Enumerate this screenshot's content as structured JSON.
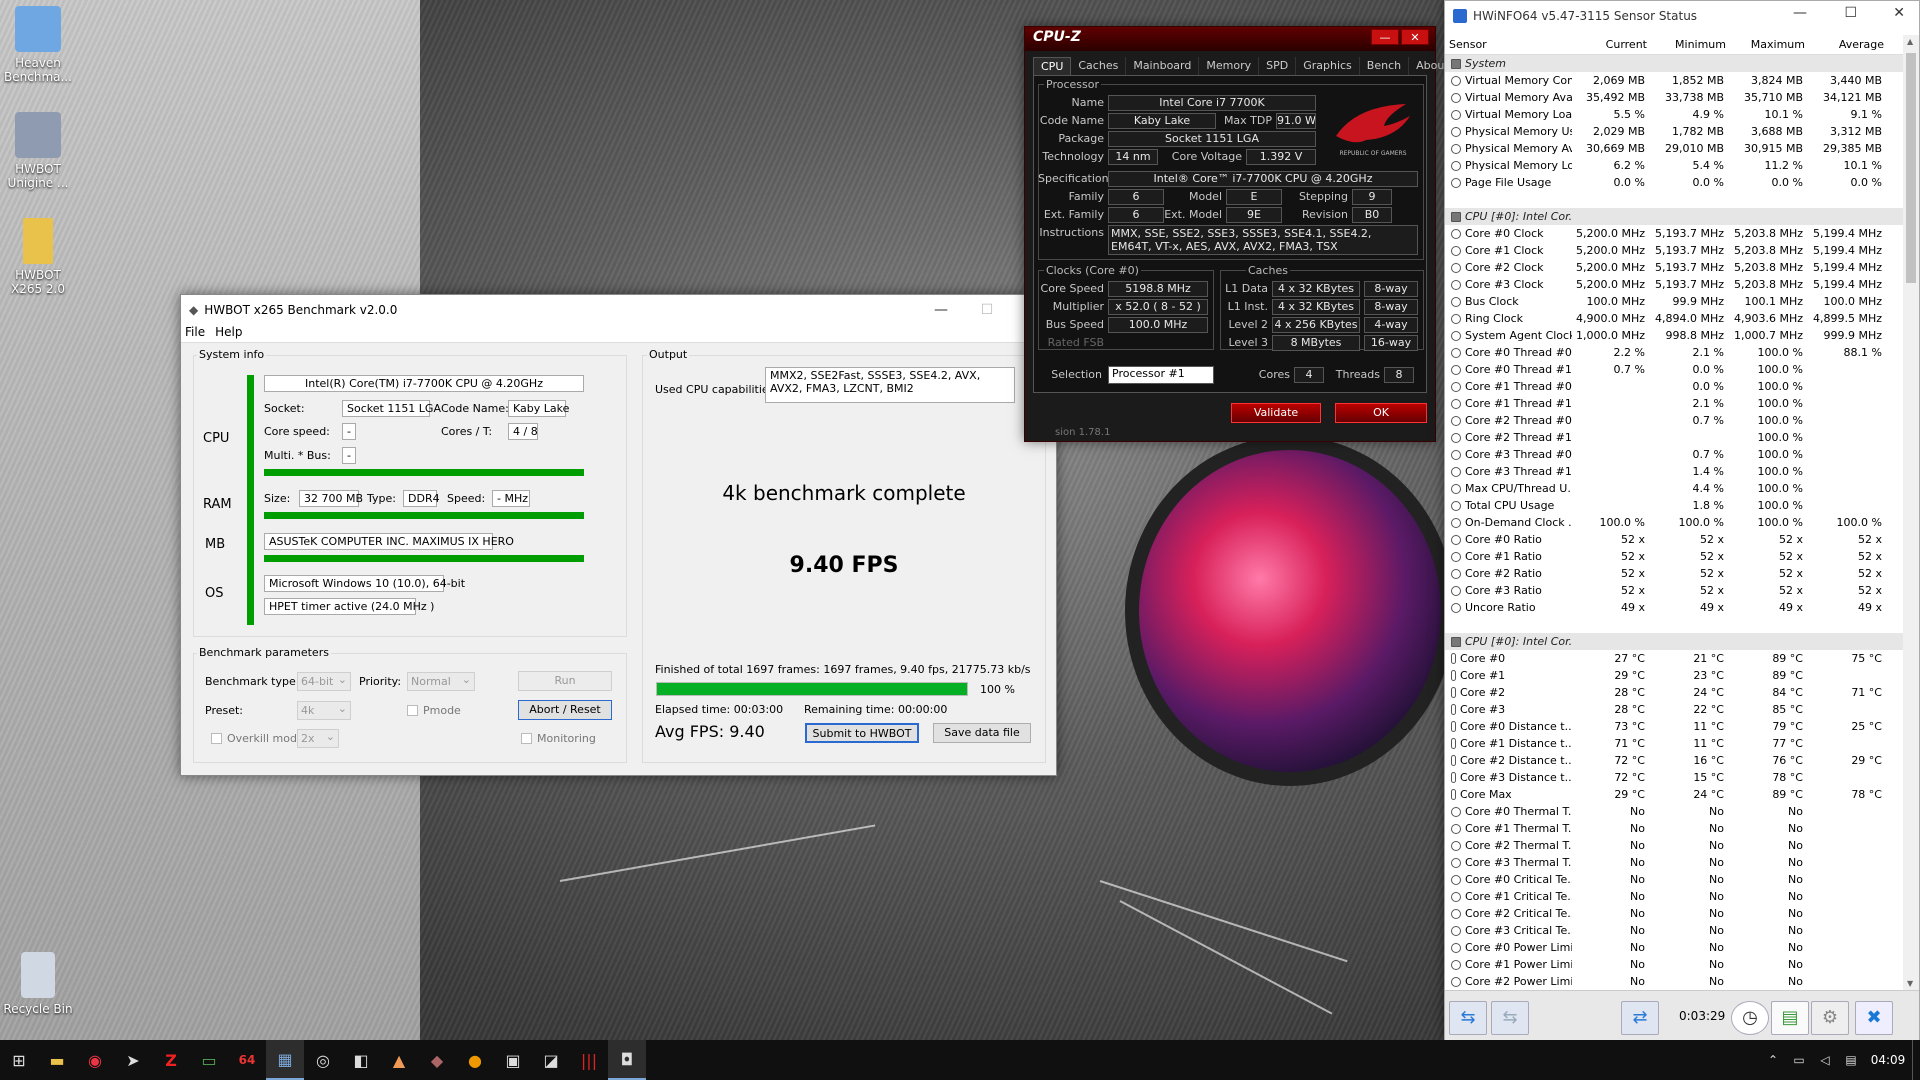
{
  "desktop": {
    "icons": [
      {
        "label": "Heaven Benchma...",
        "color": "#6fa7e2"
      },
      {
        "label": "HWBOT Unigine ...",
        "color": "#8f9bb0"
      },
      {
        "label": "HWBOT X265 2.0",
        "color": "#e8c24a"
      },
      {
        "label": "Recycle Bin",
        "color": "#cfd8e3"
      }
    ]
  },
  "hwbot": {
    "title": "HWBOT x265 Benchmark v2.0.0",
    "menu": [
      "File",
      "Help"
    ],
    "system_info": {
      "group": "System info",
      "cpu_label": "CPU",
      "ram_label": "RAM",
      "mb_label": "MB",
      "os_label": "OS",
      "cpu_name": "Intel(R) Core(TM) i7-7700K CPU @ 4.20GHz",
      "socket_label": "Socket:",
      "socket": "Socket 1151 LGA",
      "codename_label": "Code Name:",
      "codename": "Kaby Lake",
      "corespeed_label": "Core speed:",
      "corespeed": "-",
      "cores_label": "Cores / T:",
      "cores": "4 / 8",
      "multi_label": "Multi. * Bus:",
      "multi": "-",
      "size_label": "Size:",
      "size": "32 700 MB",
      "type_label": "Type:",
      "type": "DDR4",
      "speed_label": "Speed:",
      "speed": "- MHz",
      "mb": "ASUSTeK COMPUTER INC. MAXIMUS IX HERO",
      "os": "Microsoft Windows 10 (10.0), 64-bit",
      "timer": "HPET timer active (24.0 MHz )"
    },
    "params": {
      "group": "Benchmark parameters",
      "bt_label": "Benchmark type:",
      "bt": "64-bit",
      "prio_label": "Priority:",
      "prio": "Normal",
      "run": "Run",
      "preset_label": "Preset:",
      "preset": "4k",
      "pmode": "Pmode",
      "abort": "Abort / Reset",
      "overkill": "Overkill mode",
      "overkill_val": "2x",
      "monitoring": "Monitoring"
    },
    "output": {
      "group": "Output",
      "caps_label": "Used CPU capabilities:",
      "caps": "MMX2, SSE2Fast, SSSE3, SSE4.2, AVX, AVX2, FMA3, LZCNT, BMI2",
      "status": "4k benchmark complete",
      "fps": "9.40 FPS",
      "finished": "Finished of total 1697 frames: 1697 frames, 9.40 fps,  21775.73 kb/s",
      "progress": 1.0,
      "progress_text": "100 %",
      "elapsed": "Elapsed time: 00:03:00",
      "remaining": "Remaining time: 00:00:00",
      "avg": "Avg FPS:  9.40",
      "submit": "Submit to HWBOT",
      "save": "Save data file"
    }
  },
  "cpuz": {
    "title": "CPU-Z",
    "tabs": [
      "CPU",
      "Caches",
      "Mainboard",
      "Memory",
      "SPD",
      "Graphics",
      "Bench",
      "About"
    ],
    "processor_group": "Processor",
    "name_label": "Name",
    "name": "Intel Core i7 7700K",
    "code_label": "Code Name",
    "code": "Kaby Lake",
    "tdp_label": "Max TDP",
    "tdp": "91.0 W",
    "pkg_label": "Package",
    "pkg": "Socket 1151 LGA",
    "tech_label": "Technology",
    "tech": "14 nm",
    "cv_label": "Core Voltage",
    "cv": "1.392 V",
    "spec_label": "Specification",
    "spec": "Intel® Core™ i7-7700K CPU @ 4.20GHz",
    "family_label": "Family",
    "family": "6",
    "model_label": "Model",
    "model": "E",
    "stepping_label": "Stepping",
    "stepping": "9",
    "extfam_label": "Ext. Family",
    "extfam": "6",
    "extmodel_label": "Ext. Model",
    "extmodel": "9E",
    "rev_label": "Revision",
    "rev": "B0",
    "instr_label": "Instructions",
    "instr": "MMX, SSE, SSE2, SSE3, SSSE3, SSE4.1, SSE4.2, EM64T, VT-x, AES, AVX, AVX2, FMA3, TSX",
    "clocks_group": "Clocks (Core #0)",
    "cs_label": "Core Speed",
    "cs": "5198.8 MHz",
    "mult_label": "Multiplier",
    "mult": "x 52.0 ( 8 - 52 )",
    "bus_label": "Bus Speed",
    "bus": "100.0 MHz",
    "fsb_label": "Rated FSB",
    "caches_group": "Caches",
    "l1d_label": "L1 Data",
    "l1d": "4 x 32 KBytes",
    "l1d_w": "8-way",
    "l1i_label": "L1 Inst.",
    "l1i": "4 x 32 KBytes",
    "l1i_w": "8-way",
    "l2_label": "Level 2",
    "l2": "4 x 256 KBytes",
    "l2_w": "4-way",
    "l3_label": "Level 3",
    "l3": "8 MBytes",
    "l3_w": "16-way",
    "sel_label": "Selection",
    "sel": "Processor #1",
    "cores_label": "Cores",
    "cores": "4",
    "threads_label": "Threads",
    "threads": "8",
    "validate": "Validate",
    "ok": "OK",
    "version": "sion 1.78.1",
    "logo_text": "REPUBLIC OF GAMERS"
  },
  "hwinfo": {
    "title": "HWiNFO64 v5.47-3115 Sensor Status",
    "cols": [
      "Sensor",
      "Current",
      "Minimum",
      "Maximum",
      "Average"
    ],
    "rows": [
      {
        "s": 1,
        "n": "System"
      },
      {
        "n": "Virtual Memory Com...",
        "v": [
          "2,069 MB",
          "1,852 MB",
          "3,824 MB",
          "3,440 MB"
        ]
      },
      {
        "n": "Virtual Memory Avai...",
        "v": [
          "35,492 MB",
          "33,738 MB",
          "35,710 MB",
          "34,121 MB"
        ]
      },
      {
        "n": "Virtual Memory Load",
        "v": [
          "5.5 %",
          "4.9 %",
          "10.1 %",
          "9.1 %"
        ]
      },
      {
        "n": "Physical Memory Used",
        "v": [
          "2,029 MB",
          "1,782 MB",
          "3,688 MB",
          "3,312 MB"
        ]
      },
      {
        "n": "Physical Memory Av...",
        "v": [
          "30,669 MB",
          "29,010 MB",
          "30,915 MB",
          "29,385 MB"
        ]
      },
      {
        "n": "Physical Memory Load",
        "v": [
          "6.2 %",
          "5.4 %",
          "11.2 %",
          "10.1 %"
        ]
      },
      {
        "n": "Page File Usage",
        "v": [
          "0.0 %",
          "0.0 %",
          "0.0 %",
          "0.0 %"
        ]
      },
      {
        "gap": 1
      },
      {
        "s": 1,
        "n": "CPU [#0]: Intel Cor..."
      },
      {
        "n": "Core #0 Clock",
        "v": [
          "5,200.0 MHz",
          "5,193.7 MHz",
          "5,203.8 MHz",
          "5,199.4 MHz"
        ]
      },
      {
        "n": "Core #1 Clock",
        "v": [
          "5,200.0 MHz",
          "5,193.7 MHz",
          "5,203.8 MHz",
          "5,199.4 MHz"
        ]
      },
      {
        "n": "Core #2 Clock",
        "v": [
          "5,200.0 MHz",
          "5,193.7 MHz",
          "5,203.8 MHz",
          "5,199.4 MHz"
        ]
      },
      {
        "n": "Core #3 Clock",
        "v": [
          "5,200.0 MHz",
          "5,193.7 MHz",
          "5,203.8 MHz",
          "5,199.4 MHz"
        ]
      },
      {
        "n": "Bus Clock",
        "v": [
          "100.0 MHz",
          "99.9 MHz",
          "100.1 MHz",
          "100.0 MHz"
        ]
      },
      {
        "n": "Ring Clock",
        "v": [
          "4,900.0 MHz",
          "4,894.0 MHz",
          "4,903.6 MHz",
          "4,899.5 MHz"
        ]
      },
      {
        "n": "System Agent Clock",
        "v": [
          "1,000.0 MHz",
          "998.8 MHz",
          "1,000.7 MHz",
          "999.9 MHz"
        ]
      },
      {
        "n": "Core #0 Thread #0...",
        "v": [
          "2.2 %",
          "2.1 %",
          "100.0 %",
          "88.1 %"
        ]
      },
      {
        "n": "Core #0 Thread #1...",
        "v": [
          "0.7 %",
          "0.0 %",
          "100.0 %",
          ""
        ]
      },
      {
        "n": "Core #1 Thread #0...",
        "v": [
          "",
          "0.0 %",
          "100.0 %",
          ""
        ]
      },
      {
        "n": "Core #1 Thread #1...",
        "v": [
          "",
          "2.1 %",
          "100.0 %",
          ""
        ]
      },
      {
        "n": "Core #2 Thread #0...",
        "v": [
          "",
          "0.7 %",
          "100.0 %",
          ""
        ]
      },
      {
        "n": "Core #2 Thread #1...",
        "v": [
          "",
          "",
          "100.0 %",
          ""
        ]
      },
      {
        "n": "Core #3 Thread #0...",
        "v": [
          "",
          "0.7 %",
          "100.0 %",
          ""
        ]
      },
      {
        "n": "Core #3 Thread #1...",
        "v": [
          "",
          "1.4 %",
          "100.0 %",
          ""
        ]
      },
      {
        "n": "Max CPU/Thread U...",
        "v": [
          "",
          "4.4 %",
          "100.0 %",
          ""
        ]
      },
      {
        "n": "Total CPU Usage",
        "v": [
          "",
          "1.8 %",
          "100.0 %",
          ""
        ]
      },
      {
        "n": "On-Demand Clock ...",
        "v": [
          "100.0 %",
          "100.0 %",
          "100.0 %",
          "100.0 %"
        ]
      },
      {
        "n": "Core #0 Ratio",
        "v": [
          "52 x",
          "52 x",
          "52 x",
          "52 x"
        ]
      },
      {
        "n": "Core #1 Ratio",
        "v": [
          "52 x",
          "52 x",
          "52 x",
          "52 x"
        ]
      },
      {
        "n": "Core #2 Ratio",
        "v": [
          "52 x",
          "52 x",
          "52 x",
          "52 x"
        ]
      },
      {
        "n": "Core #3 Ratio",
        "v": [
          "52 x",
          "52 x",
          "52 x",
          "52 x"
        ]
      },
      {
        "n": "Uncore Ratio",
        "v": [
          "49 x",
          "49 x",
          "49 x",
          "49 x"
        ]
      },
      {
        "gap": 1
      },
      {
        "s": 1,
        "n": "CPU [#0]: Intel Cor..."
      },
      {
        "t": 1,
        "n": "Core #0",
        "v": [
          "27 °C",
          "21 °C",
          "89 °C",
          "75 °C"
        ]
      },
      {
        "t": 1,
        "n": "Core #1",
        "v": [
          "29 °C",
          "23 °C",
          "89 °C",
          ""
        ]
      },
      {
        "t": 1,
        "n": "Core #2",
        "v": [
          "28 °C",
          "24 °C",
          "84 °C",
          "71 °C"
        ]
      },
      {
        "t": 1,
        "n": "Core #3",
        "v": [
          "28 °C",
          "22 °C",
          "85 °C",
          ""
        ]
      },
      {
        "t": 1,
        "n": "Core #0 Distance t...",
        "v": [
          "73 °C",
          "11 °C",
          "79 °C",
          "25 °C"
        ]
      },
      {
        "t": 1,
        "n": "Core #1 Distance t...",
        "v": [
          "71 °C",
          "11 °C",
          "77 °C",
          ""
        ]
      },
      {
        "t": 1,
        "n": "Core #2 Distance t...",
        "v": [
          "72 °C",
          "16 °C",
          "76 °C",
          "29 °C"
        ]
      },
      {
        "t": 1,
        "n": "Core #3 Distance t...",
        "v": [
          "72 °C",
          "15 °C",
          "78 °C",
          ""
        ]
      },
      {
        "t": 1,
        "n": "Core Max",
        "v": [
          "29 °C",
          "24 °C",
          "89 °C",
          "78 °C"
        ]
      },
      {
        "n": "Core #0 Thermal T...",
        "v": [
          "No",
          "No",
          "No",
          ""
        ]
      },
      {
        "n": "Core #1 Thermal T...",
        "v": [
          "No",
          "No",
          "No",
          ""
        ]
      },
      {
        "n": "Core #2 Thermal T...",
        "v": [
          "No",
          "No",
          "No",
          ""
        ]
      },
      {
        "n": "Core #3 Thermal T...",
        "v": [
          "No",
          "No",
          "No",
          ""
        ]
      },
      {
        "n": "Core #0 Critical Te...",
        "v": [
          "No",
          "No",
          "No",
          ""
        ]
      },
      {
        "n": "Core #1 Critical Te...",
        "v": [
          "No",
          "No",
          "No",
          ""
        ]
      },
      {
        "n": "Core #2 Critical Te...",
        "v": [
          "No",
          "No",
          "No",
          ""
        ]
      },
      {
        "n": "Core #3 Critical Te...",
        "v": [
          "No",
          "No",
          "No",
          ""
        ]
      },
      {
        "n": "Core #0 Power Limi...",
        "v": [
          "No",
          "No",
          "No",
          ""
        ]
      },
      {
        "n": "Core #1 Power Limi...",
        "v": [
          "No",
          "No",
          "No",
          ""
        ]
      },
      {
        "n": "Core #2 Power Limi...",
        "v": [
          "No",
          "No",
          "No",
          ""
        ]
      }
    ],
    "timer": "0:03:29"
  },
  "taskbar": {
    "clock": "04:09"
  }
}
